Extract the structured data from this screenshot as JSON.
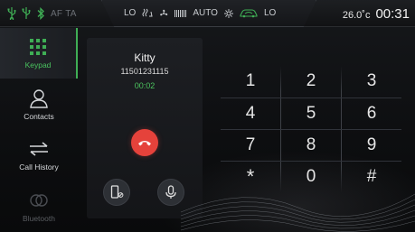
{
  "status_bar": {
    "left_icons": [
      "usb-icon",
      "usb-icon",
      "bluetooth-icon"
    ],
    "af_label": "AF",
    "ta_label": "TA",
    "climate": {
      "left_mode": "LO",
      "fan_label": "AUTO",
      "right_mode": "LO"
    },
    "temperature": "26.0˚c",
    "time": "00:31"
  },
  "sidebar": {
    "items": [
      {
        "label": "Keypad",
        "icon": "keypad-icon",
        "active": true
      },
      {
        "label": "Contacts",
        "icon": "contact-icon",
        "active": false
      },
      {
        "label": "Call History",
        "icon": "swap-arrows-icon",
        "active": false
      },
      {
        "label": "Bluetooth",
        "icon": "bluetooth-link-icon",
        "active": false,
        "disabled": true
      }
    ]
  },
  "call": {
    "name": "Kitty",
    "number": "11501231115",
    "duration": "00:02"
  },
  "keypad": {
    "keys": [
      "1",
      "2",
      "3",
      "4",
      "5",
      "6",
      "7",
      "8",
      "9",
      "*",
      "0",
      "#"
    ]
  },
  "colors": {
    "accent_green": "#4cc45f",
    "hangup_red": "#e5423b",
    "background": "#0b0c0e"
  }
}
